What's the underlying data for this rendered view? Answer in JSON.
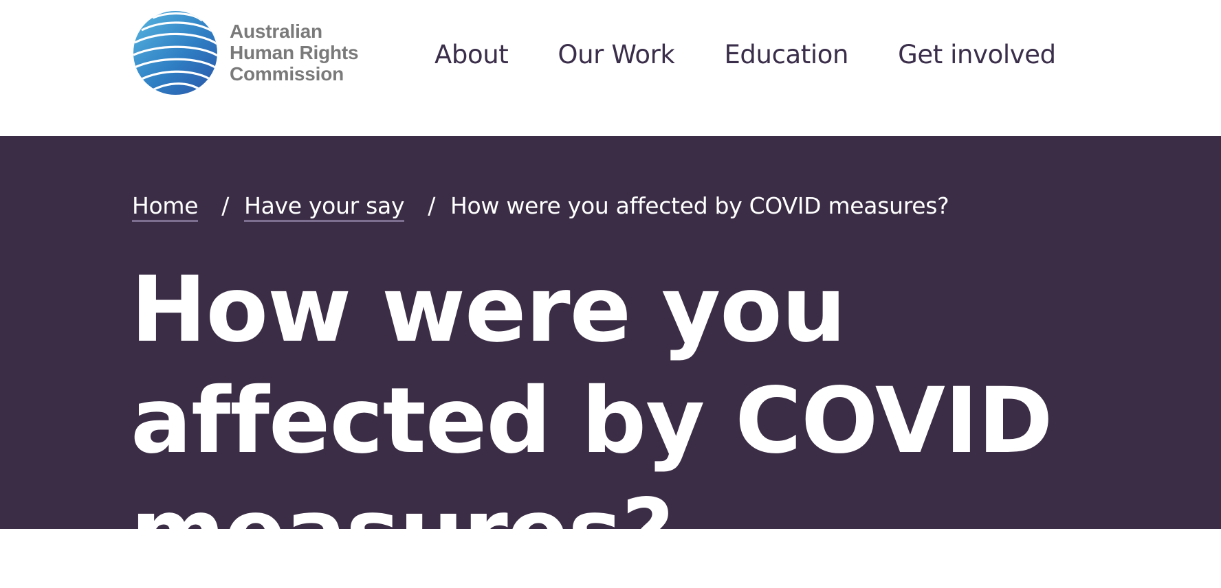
{
  "header": {
    "logo": {
      "line1": "Australian",
      "line2": "Human Rights",
      "line3": "Commission"
    },
    "nav": {
      "items": [
        {
          "label": "About"
        },
        {
          "label": "Our Work"
        },
        {
          "label": "Education"
        },
        {
          "label": "Get involved"
        }
      ]
    }
  },
  "hero": {
    "breadcrumb": {
      "home": "Home",
      "separator": "/",
      "parent": "Have your say",
      "current": "How were you affected by COVID measures?"
    },
    "title": "How were you affected by COVID measures?"
  },
  "colors": {
    "hero_background": "#3b2d46",
    "nav_text": "#3a2e4a",
    "logo_text": "#7a7a7a",
    "globe_blue": "#2f7fc4"
  },
  "icons": {
    "logo_globe": "globe-icon"
  }
}
